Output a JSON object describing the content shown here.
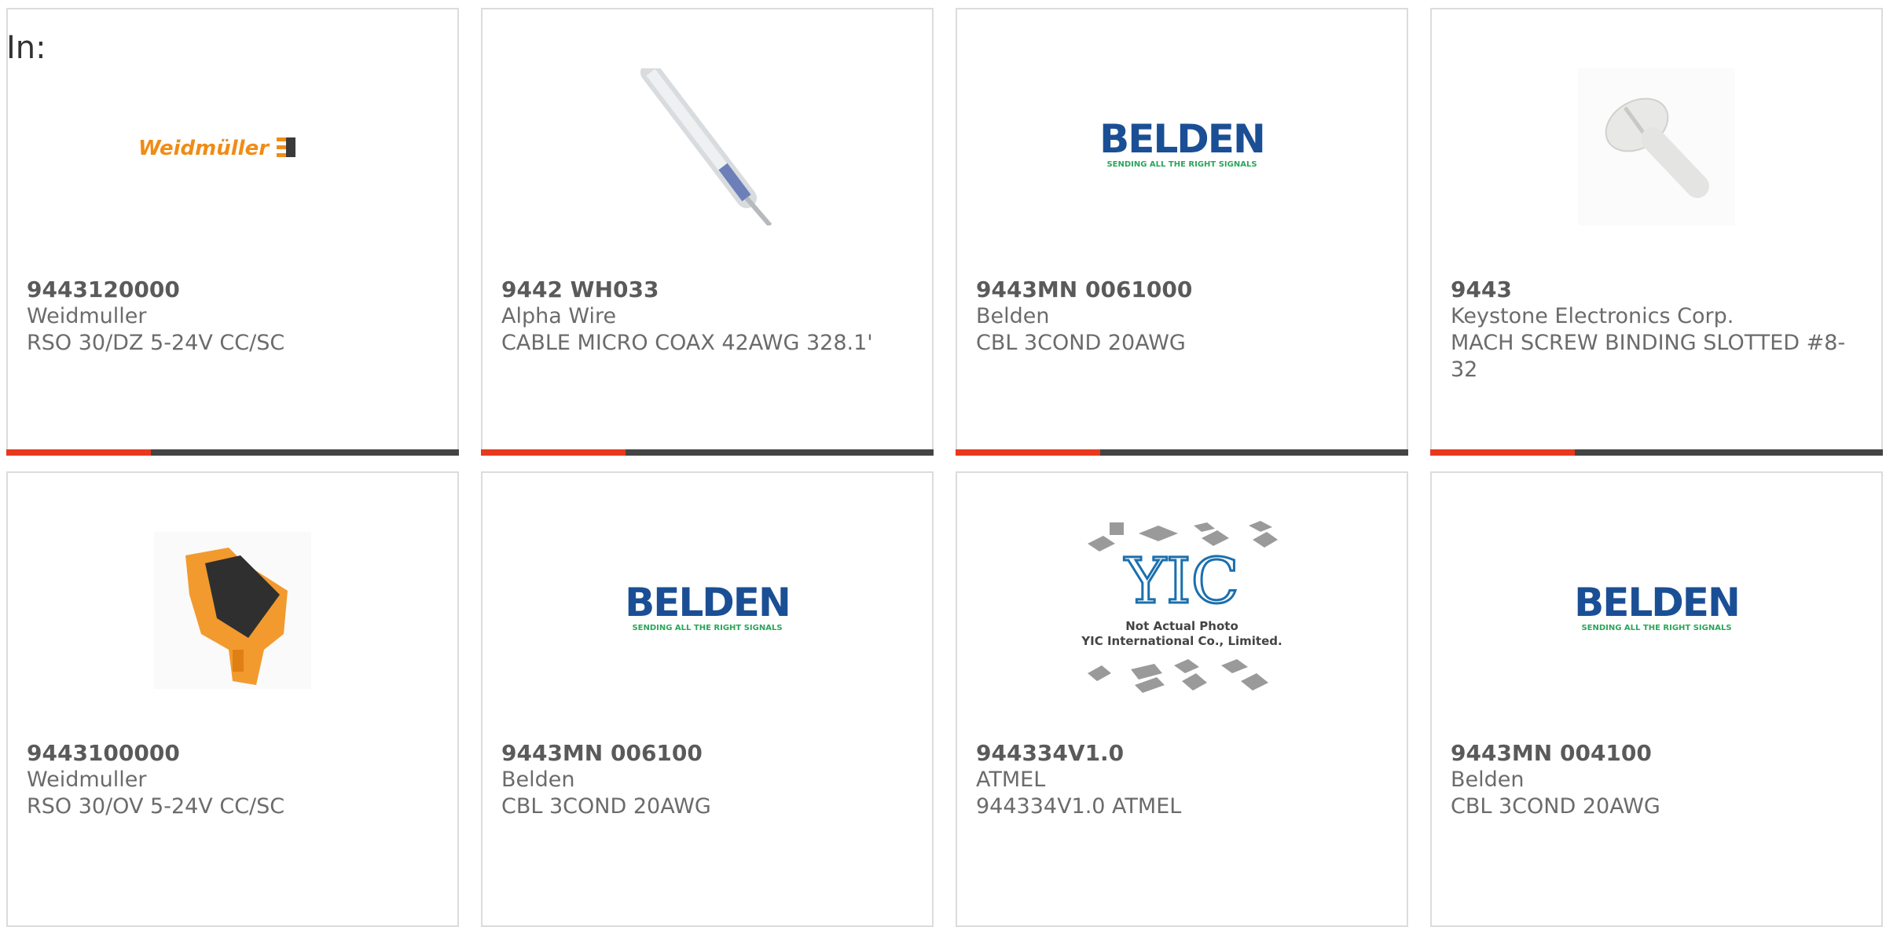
{
  "page": {
    "in_label": "In:"
  },
  "colors": {
    "accent": "#e8391d",
    "bar": "#444444",
    "text": "#6b6b6b",
    "belden_blue": "#1a4f95",
    "belden_green": "#2aa65a",
    "weidmuller_orange": "#f08c16"
  },
  "products": [
    {
      "part_number": "9443120000",
      "manufacturer": "Weidmuller",
      "description": "RSO 30/DZ 5-24V CC/SC",
      "image": "weidmuller-logo",
      "logo_text": "Weidmüller"
    },
    {
      "part_number": "9442 WH033",
      "manufacturer": "Alpha Wire",
      "description": "CABLE MICRO COAX 42AWG 328.1'",
      "image": "coax-cable-photo"
    },
    {
      "part_number": "9443MN 0061000",
      "manufacturer": "Belden",
      "description": "CBL 3COND 20AWG",
      "image": "belden-logo",
      "logo_text": "BELDEN",
      "logo_tagline": "SENDING ALL THE RIGHT SIGNALS"
    },
    {
      "part_number": "9443",
      "manufacturer": "Keystone Electronics Corp.",
      "description": "MACH SCREW BINDING SLOTTED #8-32",
      "image": "nylon-screw-photo"
    },
    {
      "part_number": "9443100000",
      "manufacturer": "Weidmuller",
      "description": "RSO 30/OV 5-24V CC/SC",
      "image": "relay-module-photo"
    },
    {
      "part_number": "9443MN 006100",
      "manufacturer": "Belden",
      "description": "CBL 3COND 20AWG",
      "image": "belden-logo",
      "logo_text": "BELDEN",
      "logo_tagline": "SENDING ALL THE RIGHT SIGNALS"
    },
    {
      "part_number": "944334V1.0",
      "manufacturer": "ATMEL",
      "description": "944334V1.0 ATMEL",
      "image": "yic-placeholder",
      "placeholder_line1": "Not Actual Photo",
      "placeholder_line2": "YIC International Co., Limited."
    },
    {
      "part_number": "9443MN 004100",
      "manufacturer": "Belden",
      "description": "CBL 3COND 20AWG",
      "image": "belden-logo",
      "logo_text": "BELDEN",
      "logo_tagline": "SENDING ALL THE RIGHT SIGNALS"
    }
  ]
}
